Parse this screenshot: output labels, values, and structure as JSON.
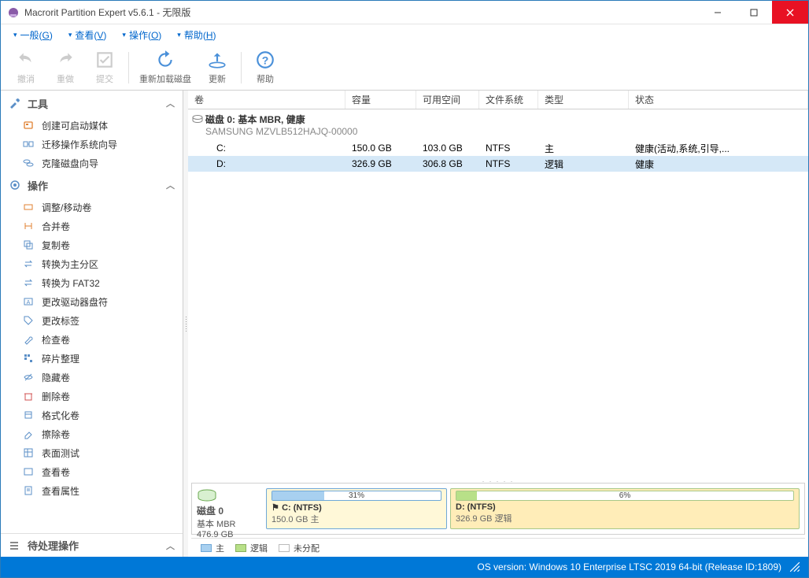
{
  "window": {
    "title": "Macrorit Partition Expert v5.6.1 - 无限版"
  },
  "menu": {
    "general": "一般(G)",
    "view": "查看(V)",
    "operation": "操作(O)",
    "help": "帮助(H)"
  },
  "toolbar": {
    "undo": "撤消",
    "redo": "重做",
    "commit": "提交",
    "reload": "重新加载磁盘",
    "refresh": "更新",
    "help": "帮助"
  },
  "sidebar": {
    "tools_header": "工具",
    "tools": [
      "创建可启动媒体",
      "迁移操作系统向导",
      "克隆磁盘向导"
    ],
    "ops_header": "操作",
    "ops": [
      "调整/移动卷",
      "合并卷",
      "复制卷",
      "转换为主分区",
      "转换为 FAT32",
      "更改驱动器盘符",
      "更改标签",
      "检查卷",
      "碎片整理",
      "隐藏卷",
      "删除卷",
      "格式化卷",
      "擦除卷",
      "表面测试",
      "查看卷",
      "查看属性"
    ],
    "pending_header": "待处理操作"
  },
  "volumes": {
    "columns": {
      "volume": "卷",
      "capacity": "容量",
      "free": "可用空间",
      "fs": "文件系统",
      "type": "类型",
      "status": "状态"
    },
    "disk_header": "磁盘  0: 基本 MBR, 健康",
    "disk_model": "SAMSUNG MZVLB512HAJQ-00000",
    "rows": [
      {
        "vol": "C:",
        "cap": "150.0 GB",
        "free": "103.0 GB",
        "fs": "NTFS",
        "type": "主",
        "status": "健康(活动,系统,引导,..."
      },
      {
        "vol": "D:",
        "cap": "326.9 GB",
        "free": "306.8 GB",
        "fs": "NTFS",
        "type": "逻辑",
        "status": "健康"
      }
    ]
  },
  "diskmap": {
    "disk_label": "磁盘  0",
    "scheme": "基本 MBR",
    "total": "476.9 GB",
    "parts": [
      {
        "pct": "31%",
        "name": "C: (NTFS)",
        "sub": "150.0 GB 主"
      },
      {
        "pct": "6%",
        "name": "D: (NTFS)",
        "sub": "326.9 GB 逻辑"
      }
    ]
  },
  "legend": {
    "primary": "主",
    "logical": "逻辑",
    "unalloc": "未分配"
  },
  "status": {
    "os": "OS version: Windows 10 Enterprise LTSC 2019  64-bit  (Release ID:1809)"
  }
}
